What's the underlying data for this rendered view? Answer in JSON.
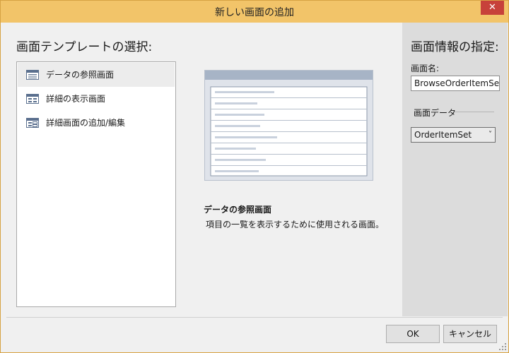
{
  "window": {
    "title": "新しい画面の追加",
    "close_label": "✕"
  },
  "left": {
    "heading": "画面テンプレートの選択:",
    "templates": [
      {
        "label": "データの参照画面",
        "selected": true
      },
      {
        "label": "詳細の表示画面",
        "selected": false
      },
      {
        "label": "詳細画面の追加/編集",
        "selected": false
      }
    ],
    "description": {
      "title": "データの参照画面",
      "text": "項目の一覧を表示するために使用される画面。"
    }
  },
  "right": {
    "heading": "画面情報の指定:",
    "name_label": "画面名:",
    "name_value": "BrowseOrderItemSet",
    "data_label": "画面データ",
    "data_value": "OrderItemSet"
  },
  "footer": {
    "ok_label": "OK",
    "cancel_label": "キャンセル"
  },
  "colors": {
    "titlebar": "#f2c469",
    "close": "#c7413a",
    "selected_item": "#ececec"
  }
}
